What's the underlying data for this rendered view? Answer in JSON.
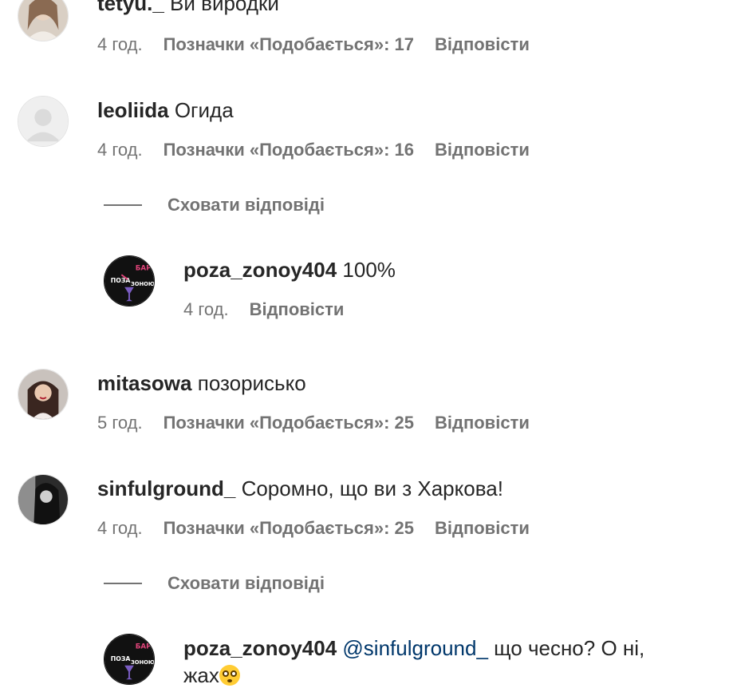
{
  "comments": [
    {
      "username": "tetyu._",
      "text": "Ви виродки",
      "time": "4 год.",
      "likes": "Позначки «Подобається»: 17",
      "reply": "Відповісти"
    },
    {
      "username": "leoliida",
      "text": "Огида",
      "time": "4 год.",
      "likes": "Позначки «Подобається»: 16",
      "reply": "Відповісти"
    },
    {
      "username": "mitasowa",
      "text": "позорисько",
      "time": "5 год.",
      "likes": "Позначки «Подобається»: 25",
      "reply": "Відповісти"
    },
    {
      "username": "sinfulground_",
      "text": "Соромно, що ви з Харкова!",
      "time": "4 год.",
      "likes": "Позначки «Подобається»: 25",
      "reply": "Відповісти"
    }
  ],
  "replies": [
    {
      "username": "poza_zonoy404",
      "text": "100%",
      "time": "4 год.",
      "reply": "Відповісти",
      "logo_text": [
        "БАР",
        "ПОЗА",
        "ЗОНОЮ"
      ]
    },
    {
      "username": "poza_zonoy404",
      "mention": "@sinfulground_",
      "text": "що чесно? О ні,",
      "text2": "жах",
      "emoji": "flushed-face"
    }
  ],
  "hide_replies_label": "Сховати відповіді",
  "colors": {
    "text": "#262626",
    "meta": "#737373",
    "mention": "#00376b",
    "logo_bg": "#111111",
    "logo_accent": "#e0447a"
  }
}
